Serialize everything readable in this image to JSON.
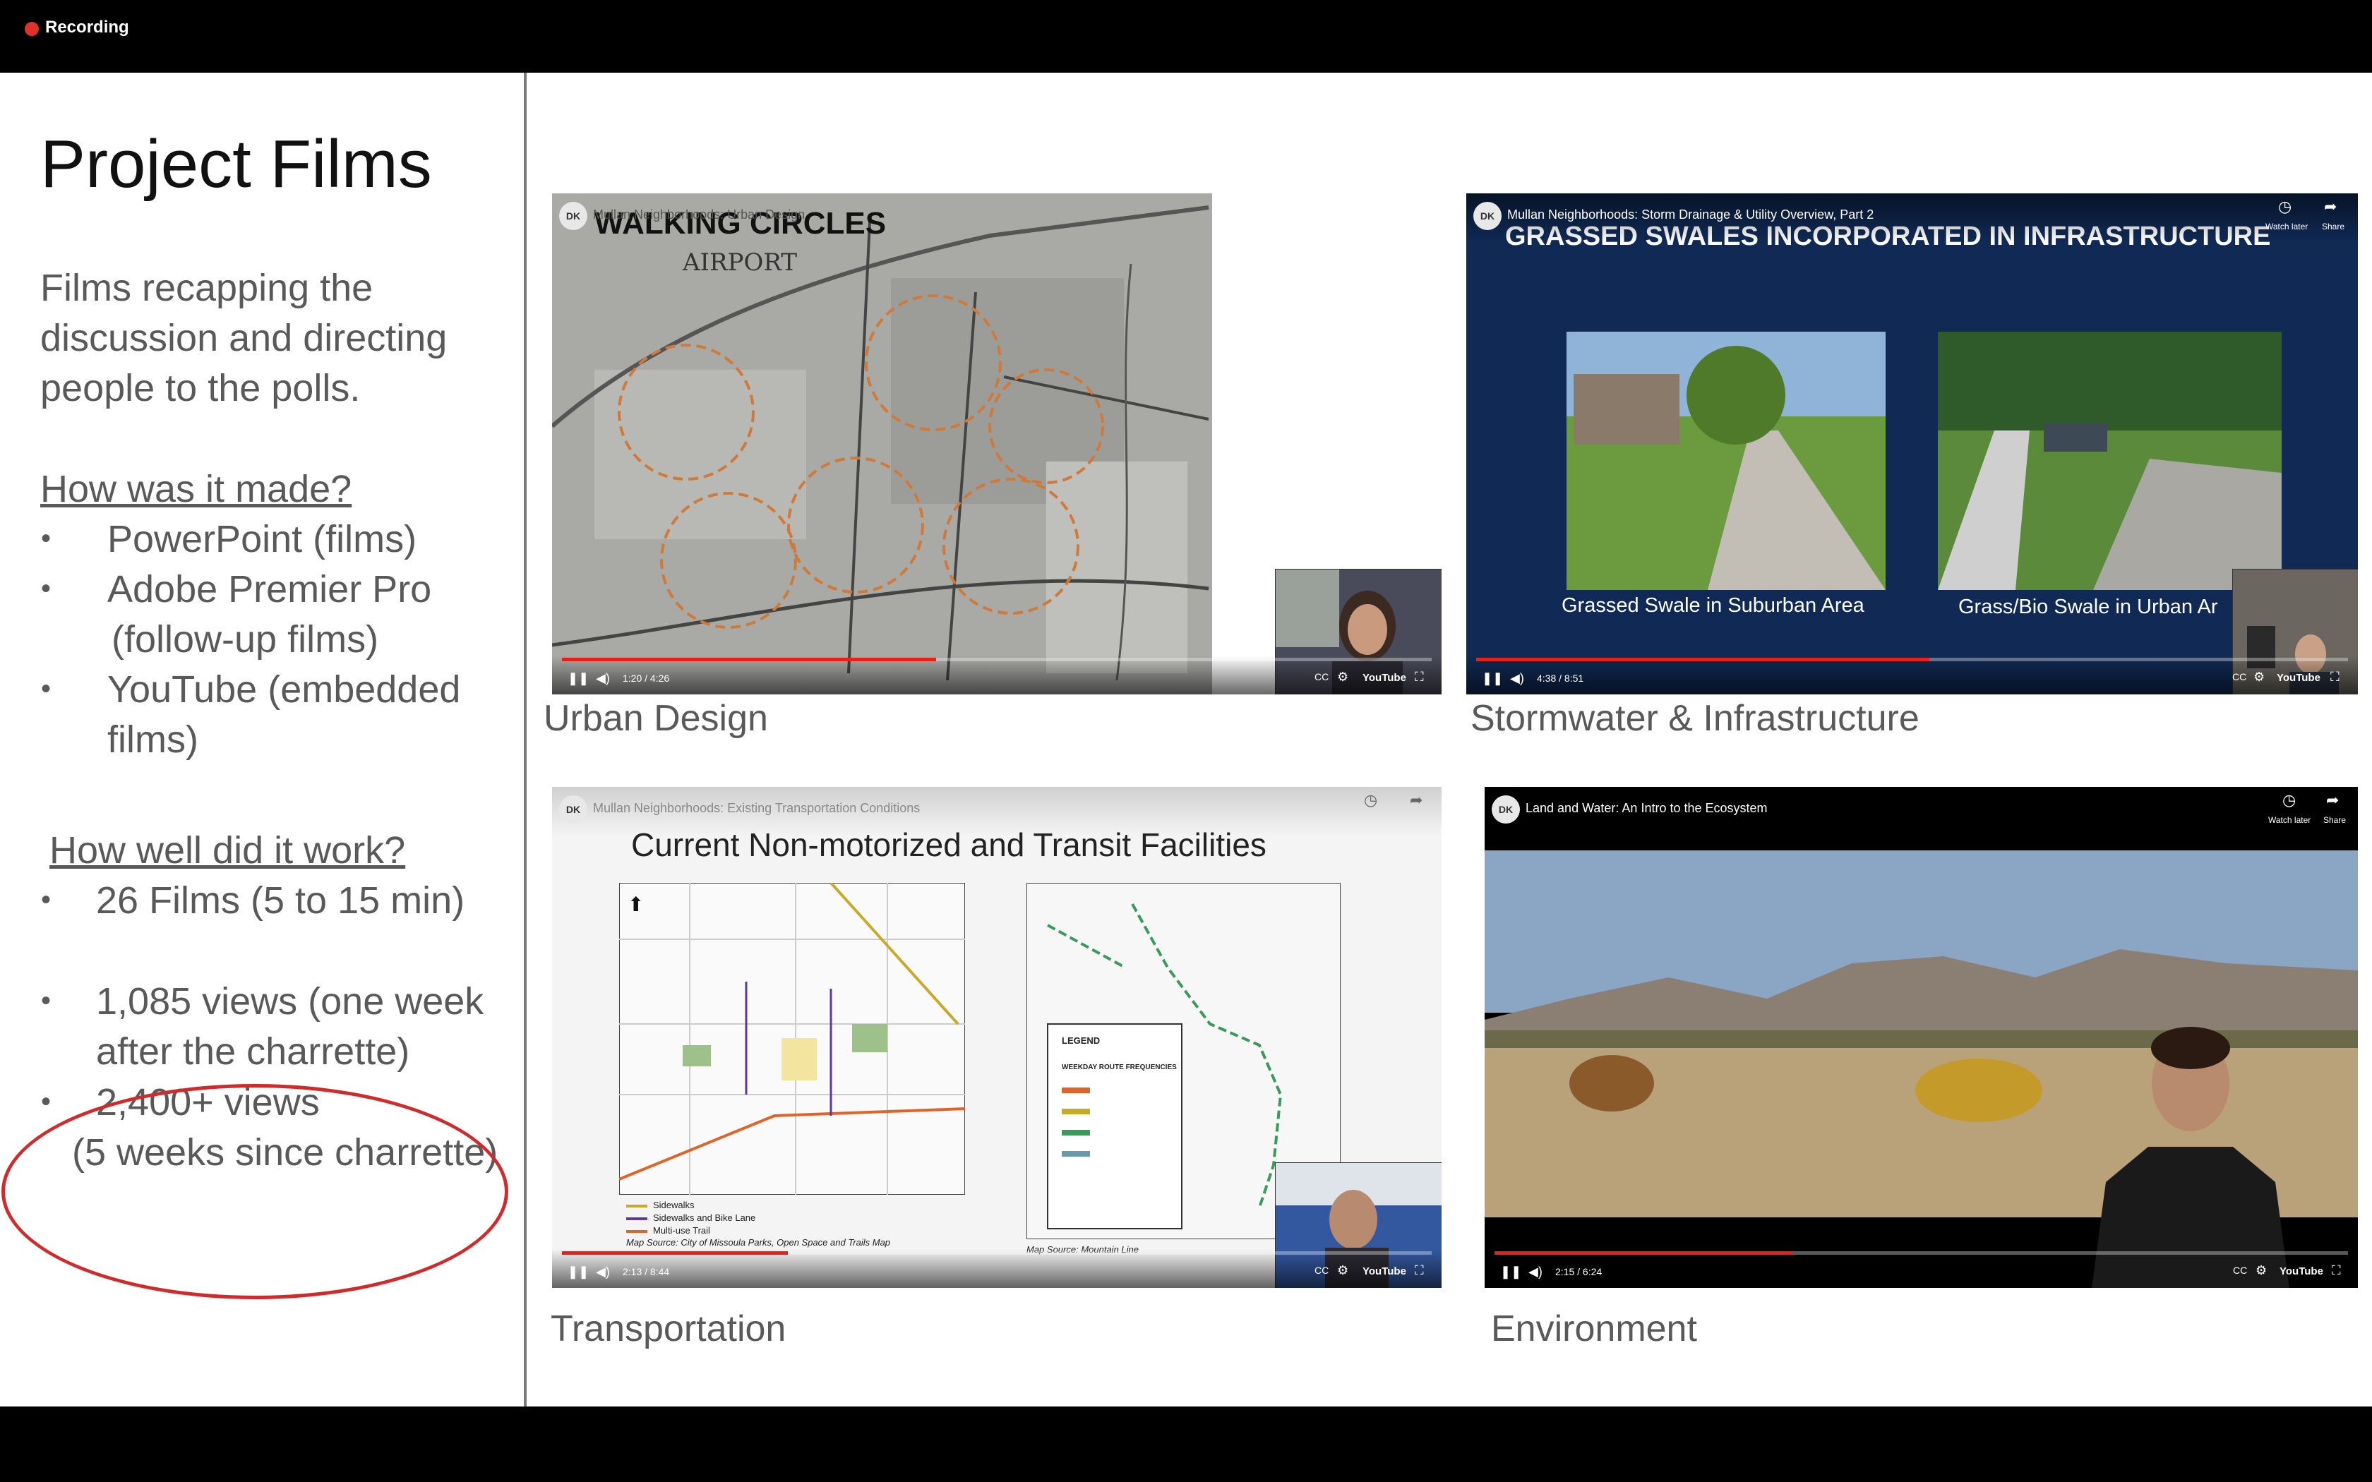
{
  "recording": {
    "label": "Recording",
    "dot_color": "#e0322b"
  },
  "slide": {
    "title": "Project Films",
    "description": "Films recapping the discussion and directing people to the polls.",
    "how_made": {
      "heading": "How was it made?",
      "items": [
        "PowerPoint (films)",
        "Adobe Premier Pro",
        "(follow-up films)",
        "YouTube (embedded",
        "films)"
      ]
    },
    "how_well": {
      "heading": "How well did it work?",
      "items": [
        "26 Films (5 to 15 min)",
        "1,085 views (one week",
        "after the charrette)",
        "2,400+ views",
        "(5 weeks since charrette)"
      ]
    }
  },
  "videos": [
    {
      "caption": "Urban Design",
      "title": "Mullan Neighborhoods: Urban Design",
      "slide_heading": "WALKING CIRCLES",
      "map_label": "AIRPORT",
      "time": "1:20 / 4:26",
      "progress": 0.43,
      "youtube": "YouTube"
    },
    {
      "caption": "Stormwater & Infrastructure",
      "title": "Mullan Neighborhoods: Storm Drainage & Utility Overview, Part 2",
      "slide_heading": "GRASSED SWALES INCORPORATED IN INFRASTRUCTURE",
      "photo_captions": [
        "Grassed Swale in Suburban Area",
        "Grass/Bio Swale in Urban Ar"
      ],
      "time": "4:38 / 8:51",
      "progress": 0.52,
      "watch_later": "Watch later",
      "share": "Share",
      "youtube": "YouTube"
    },
    {
      "caption": "Transportation",
      "title": "Mullan Neighborhoods: Existing Transportation Conditions",
      "slide_heading": "Current Non-motorized and Transit  Facilities",
      "legend_items": [
        "Sidewalks",
        "Sidewalks and Bike Lane",
        "Multi-use Trail"
      ],
      "map_source_left": "Map Source: City of Missoula Parks, Open Space and Trails Map",
      "map_source_right": "Map Source: Mountain Line",
      "legend_title": "LEGEND",
      "legend_subtitle": "WEEKDAY ROUTE FREQUENCIES",
      "time": "2:13 / 8:44",
      "progress": 0.26,
      "youtube": "YouTube"
    },
    {
      "caption": "Environment",
      "title": "Land and Water: An Intro to the Ecosystem",
      "time": "2:15 / 6:24",
      "progress": 0.35,
      "watch_later": "Watch later",
      "share": "Share",
      "youtube": "YouTube"
    }
  ],
  "icons": {
    "pause": "pause-icon",
    "volume": "volume-icon",
    "settings": "gear-icon",
    "clock": "watch-later-icon",
    "share": "share-icon",
    "captions": "captions-icon",
    "fullscreen": "fullscreen-icon"
  },
  "colors": {
    "annotation_circle": "#d02a2a",
    "progress": "#e62117",
    "text_gray": "#595959"
  }
}
